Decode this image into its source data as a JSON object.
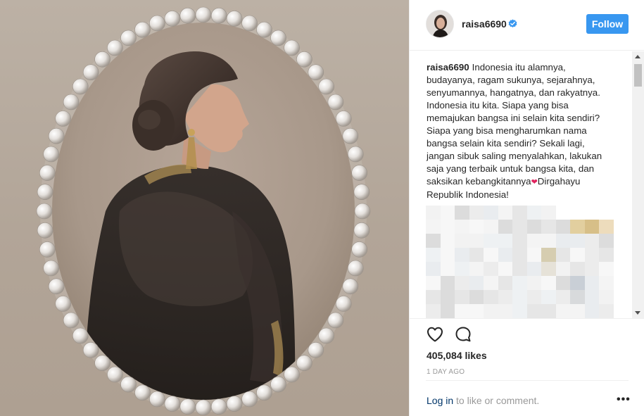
{
  "post": {
    "username": "raisa6690",
    "follow_label": "Follow",
    "caption_username": "raisa6690",
    "caption_text": "Indonesia itu alamnya, budayanya, ragam sukunya, sejarahnya, senyumannya, hangatnya, dan rakyatnya. Indonesia itu kita. Siapa yang bisa memajukan bangsa ini selain kita sendiri? Siapa yang bisa mengharumkan nama bangsa selain kita sendiri? Sekali lagi, jangan sibuk saling menyalahkan, lakukan saja yang terbaik untuk bangsa kita, dan saksikan kebangkitannya",
    "caption_emoji": "❤",
    "caption_tail": "Dirgahayu Republik Indonesia!",
    "likes": "405,084 likes",
    "timestamp": "1 DAY AGO",
    "login_link": "Log in",
    "login_suffix": " to like or comment.",
    "more_label": "•••"
  },
  "icons": {
    "like": "heart-outline-icon",
    "comment": "comment-bubble-icon",
    "verified": "verified-badge-icon",
    "more": "more-options-icon"
  },
  "colors": {
    "follow_button": "#3897f0",
    "verified_badge": "#3897f0",
    "link": "#003569",
    "muted_text": "#999999"
  }
}
